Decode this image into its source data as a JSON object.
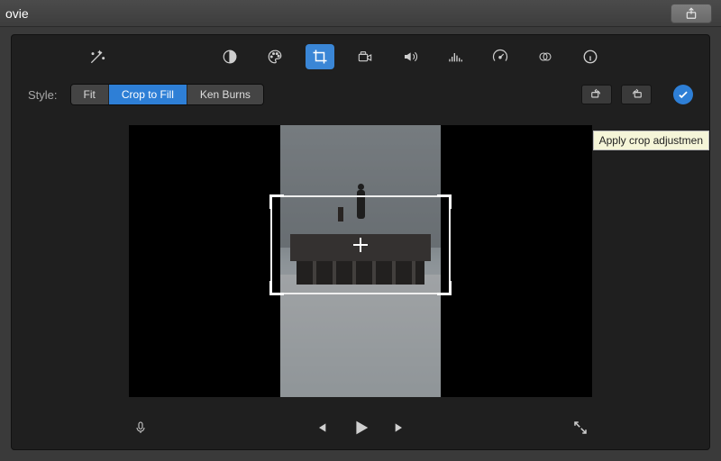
{
  "window": {
    "title": "ovie"
  },
  "toolstrip": {
    "active_tool": "crop"
  },
  "style": {
    "label": "Style:",
    "options": [
      "Fit",
      "Crop to Fill",
      "Ken Burns"
    ],
    "selected": "Crop to Fill"
  },
  "apply": {
    "tooltip": "Apply crop adjustmen"
  },
  "icons": {
    "share": "share-icon",
    "wand": "wand-icon",
    "contrast": "contrast-icon",
    "palette": "palette-icon",
    "crop": "crop-icon",
    "camera": "camera-icon",
    "volume": "volume-icon",
    "equalizer": "equalizer-icon",
    "speed": "speed-icon",
    "overlap": "overlap-circles-icon",
    "info": "info-icon",
    "rotate_ccw": "rotate-ccw-icon",
    "rotate_cw": "rotate-cw-icon",
    "check": "check-icon",
    "mic": "mic-icon",
    "prev": "prev-icon",
    "play": "play-icon",
    "next": "next-icon",
    "fullscreen": "fullscreen-icon"
  }
}
